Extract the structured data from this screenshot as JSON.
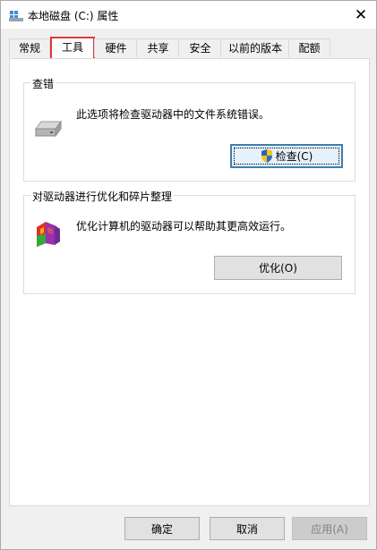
{
  "window": {
    "title": "本地磁盘 (C:) 属性",
    "close_label": "✕"
  },
  "tabs": [
    {
      "label": "常规",
      "active": false
    },
    {
      "label": "工具",
      "active": true
    },
    {
      "label": "硬件",
      "active": false
    },
    {
      "label": "共享",
      "active": false
    },
    {
      "label": "安全",
      "active": false
    },
    {
      "label": "以前的版本",
      "active": false
    },
    {
      "label": "配额",
      "active": false
    }
  ],
  "error_check": {
    "title": "查错",
    "description": "此选项将检查驱动器中的文件系统错误。",
    "button_label": "检查(C)",
    "icon": "drive-icon",
    "button_icon": "uac-shield-icon"
  },
  "optimize": {
    "title": "对驱动器进行优化和碎片整理",
    "description": "优化计算机的驱动器可以帮助其更高效运行。",
    "button_label": "优化(O)",
    "icon": "defrag-icon"
  },
  "footer": {
    "ok_label": "确定",
    "cancel_label": "取消",
    "apply_label": "应用(A)",
    "apply_enabled": false
  },
  "colors": {
    "active_tab_border": "#e0383a",
    "default_button_border": "#3c7fb1"
  }
}
